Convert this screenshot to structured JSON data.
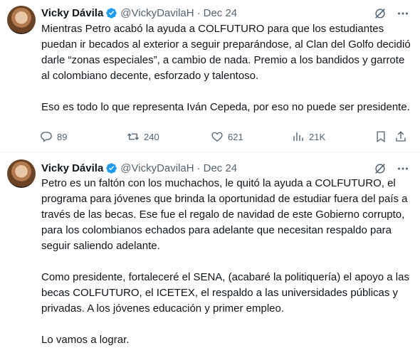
{
  "tweets": [
    {
      "author_name": "Vicky Dávila",
      "handle": "@VickyDavilaH",
      "separator": "·",
      "date": "Dec 24",
      "paragraphs": [
        "Mientras Petro acabó la ayuda a COLFUTURO para que los estudiantes puedan ir becados al exterior a seguir preparándose, al Clan del Golfo decidió darle “zonas especiales”, a cambio de nada. Premio a los bandidos y garrote al colombiano decente, esforzado y talentoso.",
        "Eso es todo lo que representa Iván Cepeda, por eso no puede ser presidente."
      ],
      "replies": "89",
      "reposts": "240",
      "likes": "621",
      "views": "21K"
    },
    {
      "author_name": "Vicky Dávila",
      "handle": "@VickyDavilaH",
      "separator": "·",
      "date": "Dec 24",
      "paragraphs": [
        "Petro es un faltón con los muchachos, le quitó la ayuda a COLFUTURO, el programa para jóvenes que brinda la oportunidad de estudiar fuera del país a través de las becas. Ese fue el regalo de navidad de este Gobierno corrupto, para los colombianos echados para adelante que necesitan respaldo para seguir saliendo adelante.",
        "Como presidente, fortaleceré el SENA, (acabaré la politiquería) el apoyo a las becas COLFUTURO, el ICETEX, el respaldo a las universidades públicas y privadas. A los jóvenes educación y primer empleo.",
        "Lo vamos a lograr."
      ]
    }
  ],
  "icons": {
    "verified": "verified-badge-icon",
    "grok": "grok-icon",
    "more": "more-icon",
    "reply": "reply-icon",
    "repost": "repost-icon",
    "like": "like-icon",
    "views": "views-icon",
    "bookmark": "bookmark-icon",
    "share": "share-icon"
  },
  "colors": {
    "text": "#0f1419",
    "secondary": "#536471",
    "verified": "#1d9bf0",
    "divider": "#eff3f4"
  }
}
